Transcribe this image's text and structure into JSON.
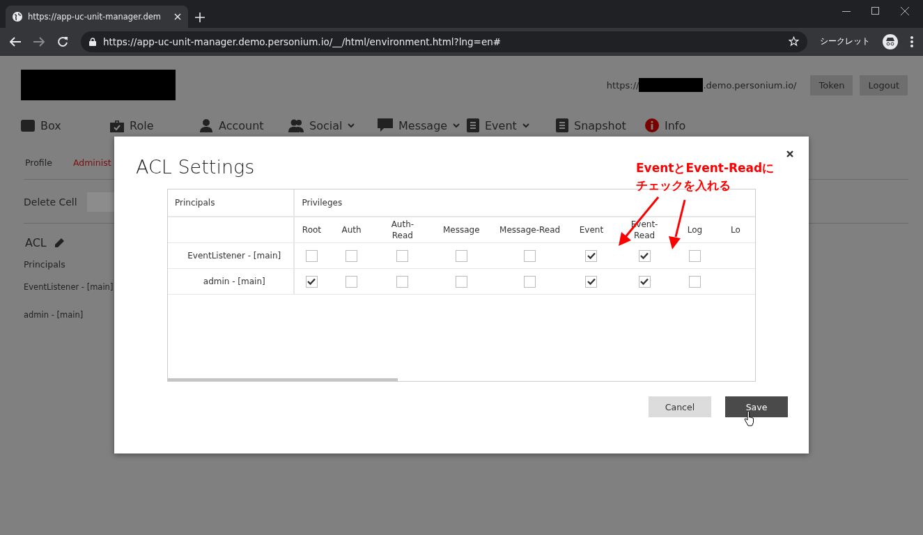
{
  "browser": {
    "tab_title": "https://app-uc-unit-manager.dem",
    "url": "https://app-uc-unit-manager.demo.personium.io/__/html/environment.html?lng=en#",
    "incognito_label": "シークレット"
  },
  "page": {
    "cell_url_prefix": "https://",
    "cell_url_suffix": ".demo.personium.io/",
    "buttons": [
      "Token",
      "Logout"
    ],
    "nav": [
      {
        "label": "Box",
        "dropdown": false
      },
      {
        "label": "Role",
        "dropdown": false
      },
      {
        "label": "Account",
        "dropdown": false
      },
      {
        "label": "Social",
        "dropdown": true
      },
      {
        "label": "Message",
        "dropdown": true
      },
      {
        "label": "Event",
        "dropdown": true
      },
      {
        "label": "Snapshot",
        "dropdown": false
      },
      {
        "label": "Info",
        "dropdown": false
      }
    ],
    "subtabs": [
      {
        "label": "Profile",
        "selected": false
      },
      {
        "label": "Administ",
        "selected": true
      }
    ],
    "delete_cell_label": "Delete Cell",
    "acl_title": "ACL",
    "principals_label": "Principals",
    "principals": [
      "EventListener - [main]",
      "admin - [main]"
    ]
  },
  "dialog": {
    "title": "ACL Settings",
    "principals_header": "Principals",
    "privileges_header": "Privileges",
    "columns": [
      "Root",
      "Auth",
      "Auth-\nRead",
      "Message",
      "Message-Read",
      "Event",
      "Event-\nRead",
      "Log",
      "Lo"
    ],
    "rows": [
      {
        "principal": "EventListener - [main]",
        "privileges": [
          {
            "checked": false
          },
          {
            "checked": false
          },
          {
            "checked": false
          },
          {
            "checked": false
          },
          {
            "checked": false
          },
          {
            "checked": true
          },
          {
            "checked": true
          },
          {
            "checked": false
          }
        ]
      },
      {
        "principal": "admin - [main]",
        "privileges": [
          {
            "checked": true
          },
          {
            "checked": false
          },
          {
            "checked": false
          },
          {
            "checked": false
          },
          {
            "checked": false
          },
          {
            "checked": true
          },
          {
            "checked": true
          },
          {
            "checked": false
          }
        ]
      }
    ],
    "buttons": [
      {
        "label": "Cancel",
        "kind": "secondary"
      },
      {
        "label": "Save",
        "kind": "primary"
      }
    ]
  },
  "annotation": {
    "lines": [
      "EventとEvent-Readに",
      "チェックを入れる"
    ]
  }
}
